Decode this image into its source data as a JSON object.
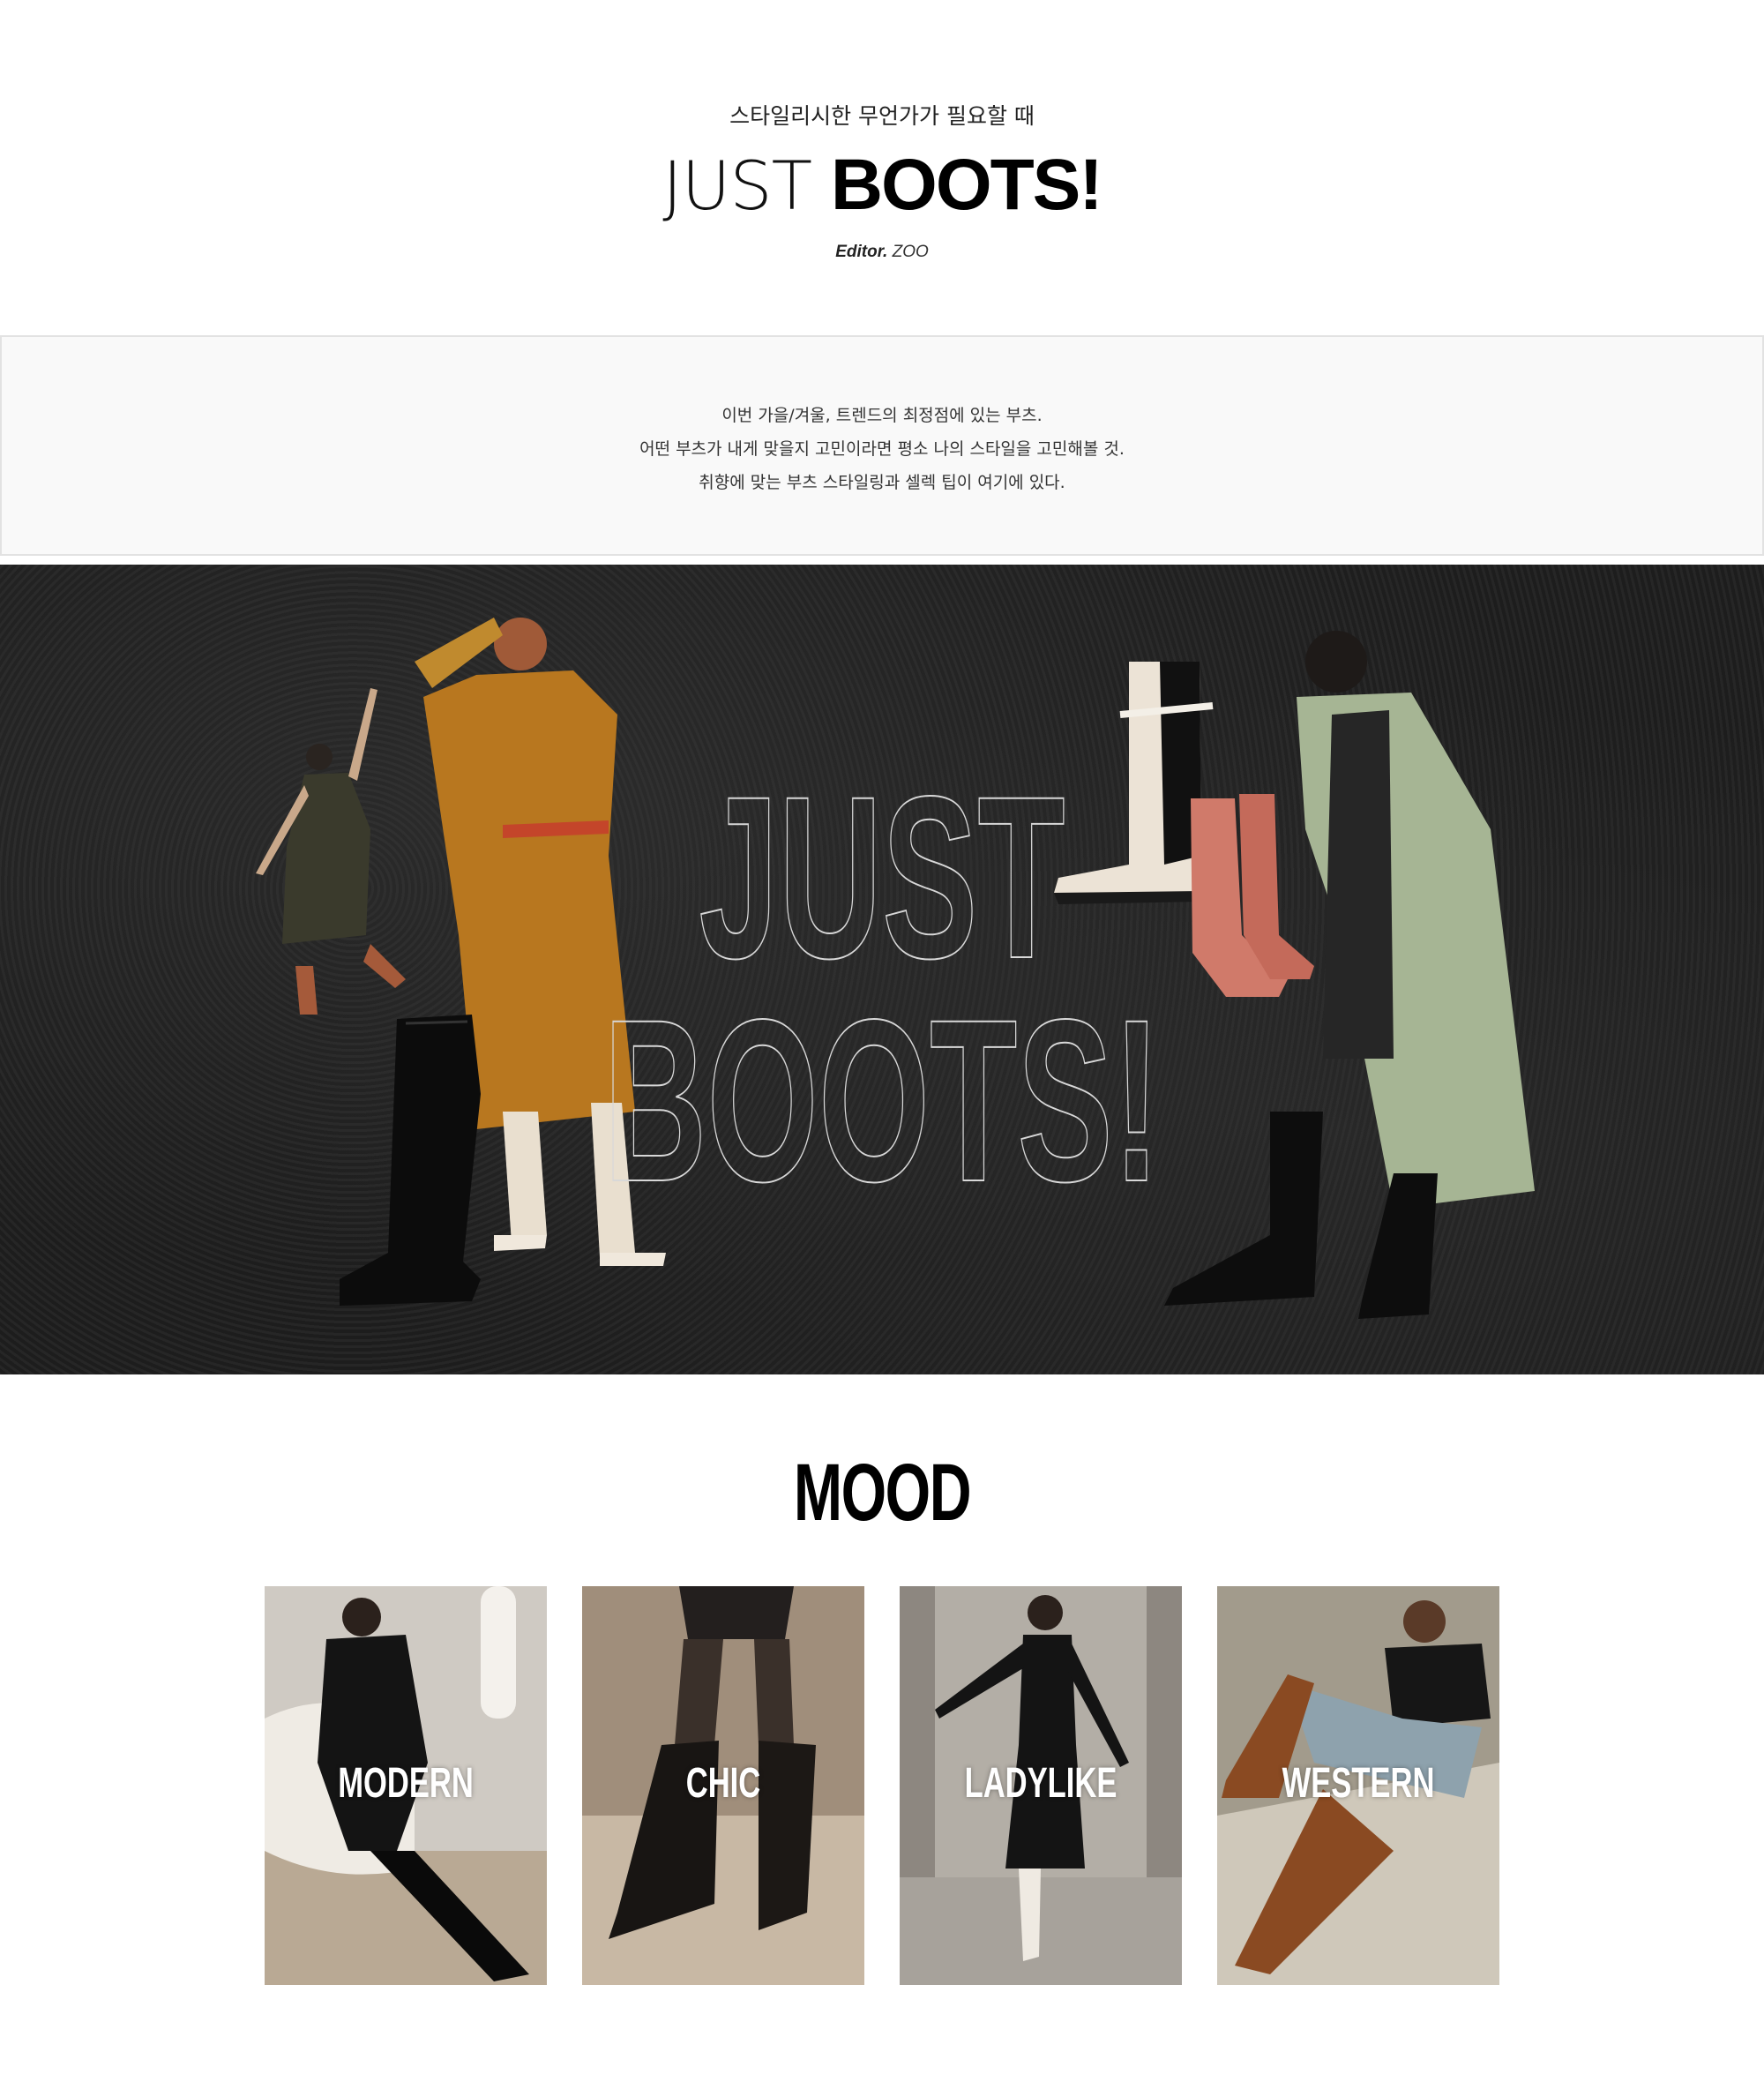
{
  "header": {
    "subtitle": "스타일리시한 무언가가 필요할 때",
    "title_light": "JUST",
    "title_bold": "BOOTS!",
    "editor_label": "Editor.",
    "editor_name": "ZOO"
  },
  "intro": {
    "lines": [
      "이번 가을/겨울, 트렌드의 최정점에 있는 부츠.",
      "어떤 부츠가 내게 맞을지 고민이라면 평소 나의 스타일을 고민해볼 것.",
      "취향에 맞는 부츠 스타일링과 셀렉 팁이 여기에 있다."
    ]
  },
  "hero": {
    "title_line1": "JUST",
    "title_line2": "BOOTS!"
  },
  "mood": {
    "title": "MOOD",
    "cards": [
      {
        "label": "MODERN"
      },
      {
        "label": "CHIC"
      },
      {
        "label": "LADYLIKE"
      },
      {
        "label": "WESTERN"
      }
    ]
  },
  "colors": {
    "hero_bg": "#202020",
    "card_modern": "#cfcac3",
    "card_chic": "#a08e7b",
    "card_ladylike": "#8d8780",
    "card_western": "#a29b8c"
  }
}
